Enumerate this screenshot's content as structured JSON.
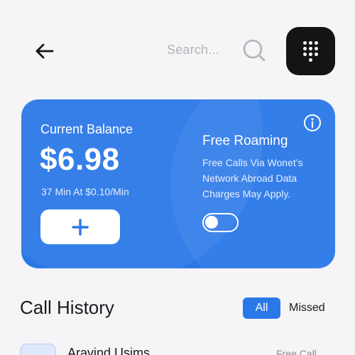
{
  "header": {
    "back_icon": "arrow-left-icon",
    "search_placeholder": "Search...",
    "search_icon": "search-icon",
    "dialpad_icon": "dialpad-icon",
    "colors": {
      "dialpad_bg": "#141416",
      "search_text": "#b4b4b8"
    }
  },
  "balance_card": {
    "label": "Current Balance",
    "amount": "$6.98",
    "rate": "37 Min At $0.10/Min",
    "add_icon": "plus-icon",
    "info_icon": "info-icon",
    "roaming_title": "Free Roaming",
    "roaming_description": "Free Calls Via Wonet’s Network Abroad Data Charges May Apply.",
    "roaming_enabled": false,
    "colors": {
      "card_bg": "#2a78e8",
      "accent": "#2a78e8"
    }
  },
  "call_history": {
    "title": "Call History",
    "filters": [
      {
        "label": "All",
        "selected": true
      },
      {
        "label": "Missed",
        "selected": false
      }
    ],
    "items": [
      {
        "name": "Aravind Usims",
        "type": "Free Call"
      }
    ]
  }
}
